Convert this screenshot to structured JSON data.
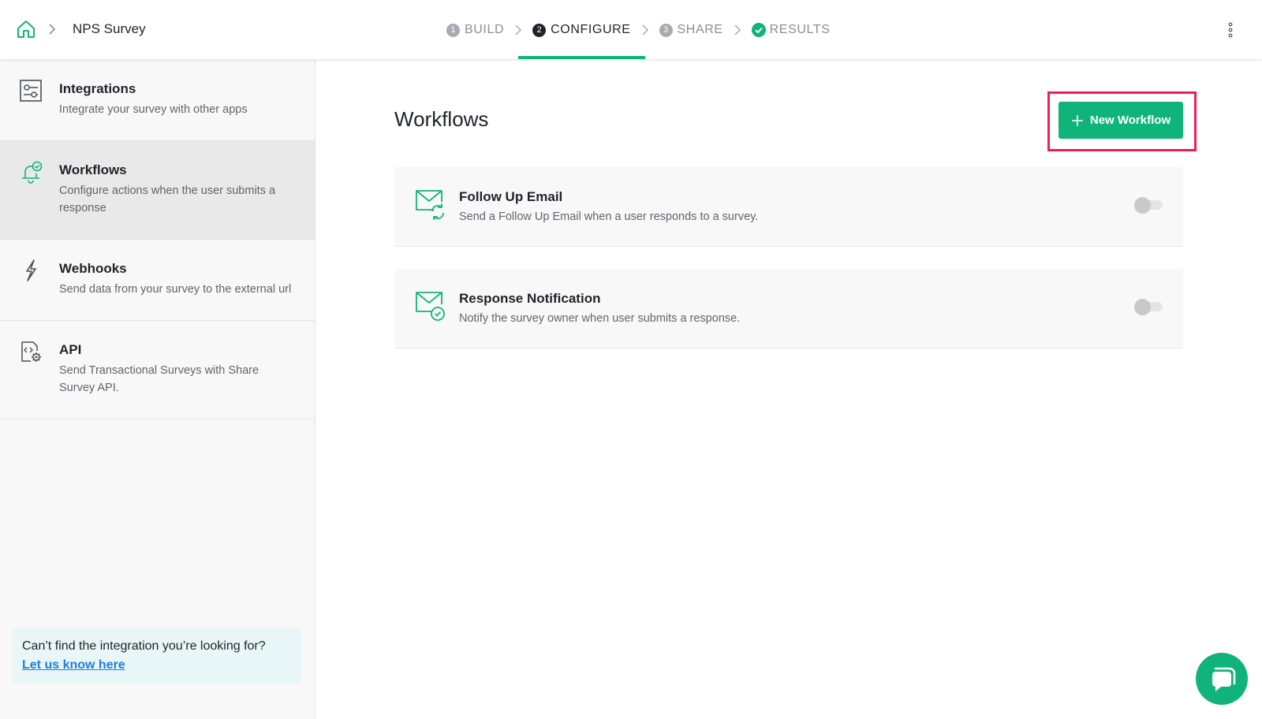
{
  "header": {
    "survey_name": "NPS Survey",
    "steps": [
      {
        "number": "1",
        "label": "BUILD"
      },
      {
        "number": "2",
        "label": "CONFIGURE"
      },
      {
        "number": "3",
        "label": "SHARE"
      },
      {
        "number": "",
        "label": "RESULTS"
      }
    ],
    "active_step": "CONFIGURE"
  },
  "sidebar": {
    "items": [
      {
        "title": "Integrations",
        "description": "Integrate your survey with other apps",
        "icon": "integrations-icon"
      },
      {
        "title": "Workflows",
        "description": "Configure actions when the user submits a response",
        "icon": "workflow-bell-icon"
      },
      {
        "title": "Webhooks",
        "description": "Send data from your survey to the external url",
        "icon": "lightning-icon"
      },
      {
        "title": "API",
        "description": "Send Transactional Surveys with Share Survey API.",
        "icon": "api-gear-icon"
      }
    ],
    "active_item": "Workflows",
    "help": {
      "text": "Can’t find the integration you’re looking for?",
      "link": "Let us know here"
    }
  },
  "main": {
    "title": "Workflows",
    "new_workflow_label": "New Workflow",
    "workflows": [
      {
        "title": "Follow Up Email",
        "description": "Send a Follow Up Email when a user responds to a survey.",
        "enabled": false,
        "icon": "mail-refresh-icon"
      },
      {
        "title": "Response Notification",
        "description": "Notify the survey owner when user submits a response.",
        "enabled": false,
        "icon": "mail-check-icon"
      }
    ]
  },
  "colors": {
    "accent": "#10b47b",
    "highlight": "#ee1d5a",
    "link": "#1e7fd8"
  }
}
